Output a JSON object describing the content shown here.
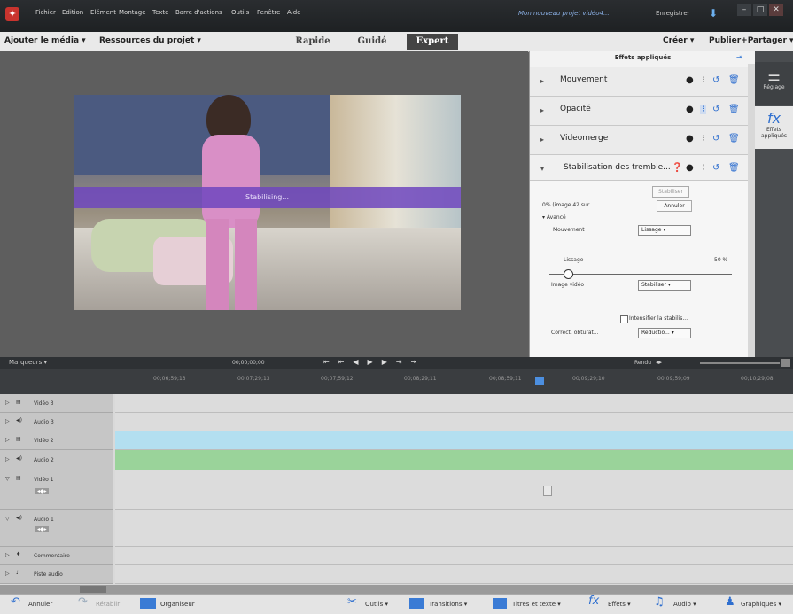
{
  "menubar": {
    "items": [
      "Fichier",
      "Edition",
      "Elément",
      "Montage",
      "Texte",
      "Barre d'actions",
      "Outils",
      "Fenêtre",
      "Aide"
    ],
    "project_title": "Mon nouveau projet vidéo4...",
    "save_label": "Enregistrer"
  },
  "toolbar": {
    "add_media": "Ajouter le média ▾",
    "project_assets": "Ressources du projet ▾",
    "modes": [
      "Rapide",
      "Guidé",
      "Expert"
    ],
    "active_mode": "Expert",
    "create": "Créer ▾",
    "publish": "Publier+Partager ▾"
  },
  "monitor": {
    "stabilizing_text": "Stabilising..."
  },
  "effects_panel": {
    "title": "Effets appliqués",
    "effects": [
      "Mouvement",
      "Opacité",
      "Videomerge",
      "Stabilisation des tremble..."
    ],
    "stabilize_button": "Stabiliser",
    "frame_status": "0% (image 42 sur ...",
    "cancel_button": "Annuler",
    "advanced_label": "Avancé",
    "motion_label": "Mouvement",
    "motion_value": "Lissage",
    "smoothing_label": "Lissage",
    "smoothing_value": "50 %",
    "smoothing_fraction": 0.1,
    "result_label": "Image vidéo",
    "result_value": "Stabiliser",
    "intensify_label": "Intensifier la stabilis...",
    "correction_label": "Correct. obturat...",
    "correction_value": "Réductio..."
  },
  "right_panel": {
    "adjust_label": "Réglage",
    "effects_label": "Effets appliqués"
  },
  "timeline": {
    "markers_label": "Marqueurs ▾",
    "timecode": "00;00;00;00",
    "render_label": "Rendu",
    "ruler": [
      "00;06;59;13",
      "00;07;29;13",
      "00;07;59;12",
      "00;08;29;11",
      "00;08;59;11",
      "00;09;29;10",
      "00;09;59;09",
      "00;10;29;08"
    ],
    "tracks": [
      "Vidéo 3",
      "Audio 3",
      "Vidéo 2",
      "Audio 2",
      "Vidéo 1",
      "Audio 1",
      "Commentaire",
      "Piste audio"
    ]
  },
  "bottombar": {
    "undo": "Annuler",
    "redo": "Rétablir",
    "organizer": "Organiseur",
    "tools": "Outils ▾",
    "transitions": "Transitions ▾",
    "titles": "Titres et texte ▾",
    "effects": "Effets ▾",
    "audio": "Audio ▾",
    "graphics": "Graphiques ▾"
  },
  "colors": {
    "stab_bar": "#6e46be",
    "playhead": "#e0463c",
    "video2_track": "#b3dff0",
    "audio2_track": "#9ad39a"
  }
}
